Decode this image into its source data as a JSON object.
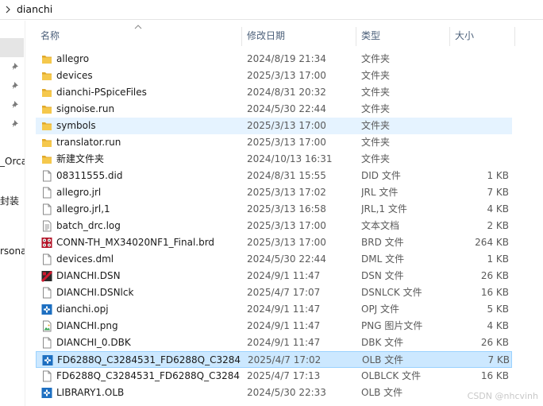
{
  "breadcrumb": {
    "path": "dianchi"
  },
  "nav": {
    "labels": [
      "_Orca",
      "封装",
      "rsona"
    ]
  },
  "columns": {
    "name": "名称",
    "modified": "修改日期",
    "type": "类型",
    "size": "大小"
  },
  "files": [
    {
      "name": "allegro",
      "modified": "2024/8/19 21:34",
      "type": "文件夹",
      "size": "",
      "icon": "folder-icon"
    },
    {
      "name": "devices",
      "modified": "2025/3/13 17:00",
      "type": "文件夹",
      "size": "",
      "icon": "folder-icon"
    },
    {
      "name": "dianchi-PSpiceFiles",
      "modified": "2024/8/31 20:32",
      "type": "文件夹",
      "size": "",
      "icon": "folder-icon"
    },
    {
      "name": "signoise.run",
      "modified": "2024/5/30 22:44",
      "type": "文件夹",
      "size": "",
      "icon": "folder-icon"
    },
    {
      "name": "symbols",
      "modified": "2025/3/13 17:00",
      "type": "文件夹",
      "size": "",
      "icon": "folder-icon"
    },
    {
      "name": "translator.run",
      "modified": "2025/3/13 17:00",
      "type": "文件夹",
      "size": "",
      "icon": "folder-icon"
    },
    {
      "name": "新建文件夹",
      "modified": "2024/10/13 16:31",
      "type": "文件夹",
      "size": "",
      "icon": "folder-icon"
    },
    {
      "name": "08311555.did",
      "modified": "2024/8/31 15:55",
      "type": "DID 文件",
      "size": "1 KB",
      "icon": "document-icon"
    },
    {
      "name": "allegro.jrl",
      "modified": "2025/3/13 17:02",
      "type": "JRL 文件",
      "size": "7 KB",
      "icon": "document-icon"
    },
    {
      "name": "allegro.jrl,1",
      "modified": "2025/3/13 16:58",
      "type": "JRL,1 文件",
      "size": "4 KB",
      "icon": "document-icon"
    },
    {
      "name": "batch_drc.log",
      "modified": "2025/3/13 17:00",
      "type": "文本文档",
      "size": "2 KB",
      "icon": "text-document-icon"
    },
    {
      "name": "CONN-TH_MX34020NF1_Final.brd",
      "modified": "2025/3/13 17:00",
      "type": "BRD 文件",
      "size": "264 KB",
      "icon": "allegro-board-icon"
    },
    {
      "name": "devices.dml",
      "modified": "2024/5/30 22:44",
      "type": "DML 文件",
      "size": "1 KB",
      "icon": "document-icon"
    },
    {
      "name": "DIANCHI.DSN",
      "modified": "2024/9/1 11:47",
      "type": "DSN 文件",
      "size": "26 KB",
      "icon": "capture-design-icon"
    },
    {
      "name": "DIANCHI.DSNlck",
      "modified": "2025/4/7 17:07",
      "type": "DSNLCK 文件",
      "size": "16 KB",
      "icon": "document-icon"
    },
    {
      "name": "dianchi.opj",
      "modified": "2024/9/1 11:47",
      "type": "OPJ 文件",
      "size": "5 KB",
      "icon": "capture-project-icon"
    },
    {
      "name": "DIANCHI.png",
      "modified": "2024/9/1 11:47",
      "type": "PNG 图片文件",
      "size": "4 KB",
      "icon": "image-file-icon"
    },
    {
      "name": "DIANCHI_0.DBK",
      "modified": "2024/9/1 11:47",
      "type": "DBK 文件",
      "size": "26 KB",
      "icon": "document-icon"
    },
    {
      "name": "FD6288Q_C3284531_FD6288Q_C3284...",
      "modified": "2025/4/7 17:02",
      "type": "OLB 文件",
      "size": "7 KB",
      "icon": "capture-library-icon"
    },
    {
      "name": "FD6288Q_C3284531_FD6288Q_C3284...",
      "modified": "2025/4/7 17:13",
      "type": "OLBLCK 文件",
      "size": "16 KB",
      "icon": "document-icon"
    },
    {
      "name": "LIBRARY1.OLB",
      "modified": "2024/5/30 22:33",
      "type": "OLB 文件",
      "size": "",
      "icon": "capture-library-icon"
    }
  ],
  "state": {
    "hover_row": 4,
    "selected_row": 18
  },
  "colors": {
    "folder": "#f0c24b",
    "hover": "#e5f3ff",
    "selected": "#cce8ff",
    "header_text": "#4c607a",
    "capture_blue": "#1d6fc1",
    "allegro_red": "#c0182d"
  },
  "watermark": "CSDN @nhcvinh"
}
